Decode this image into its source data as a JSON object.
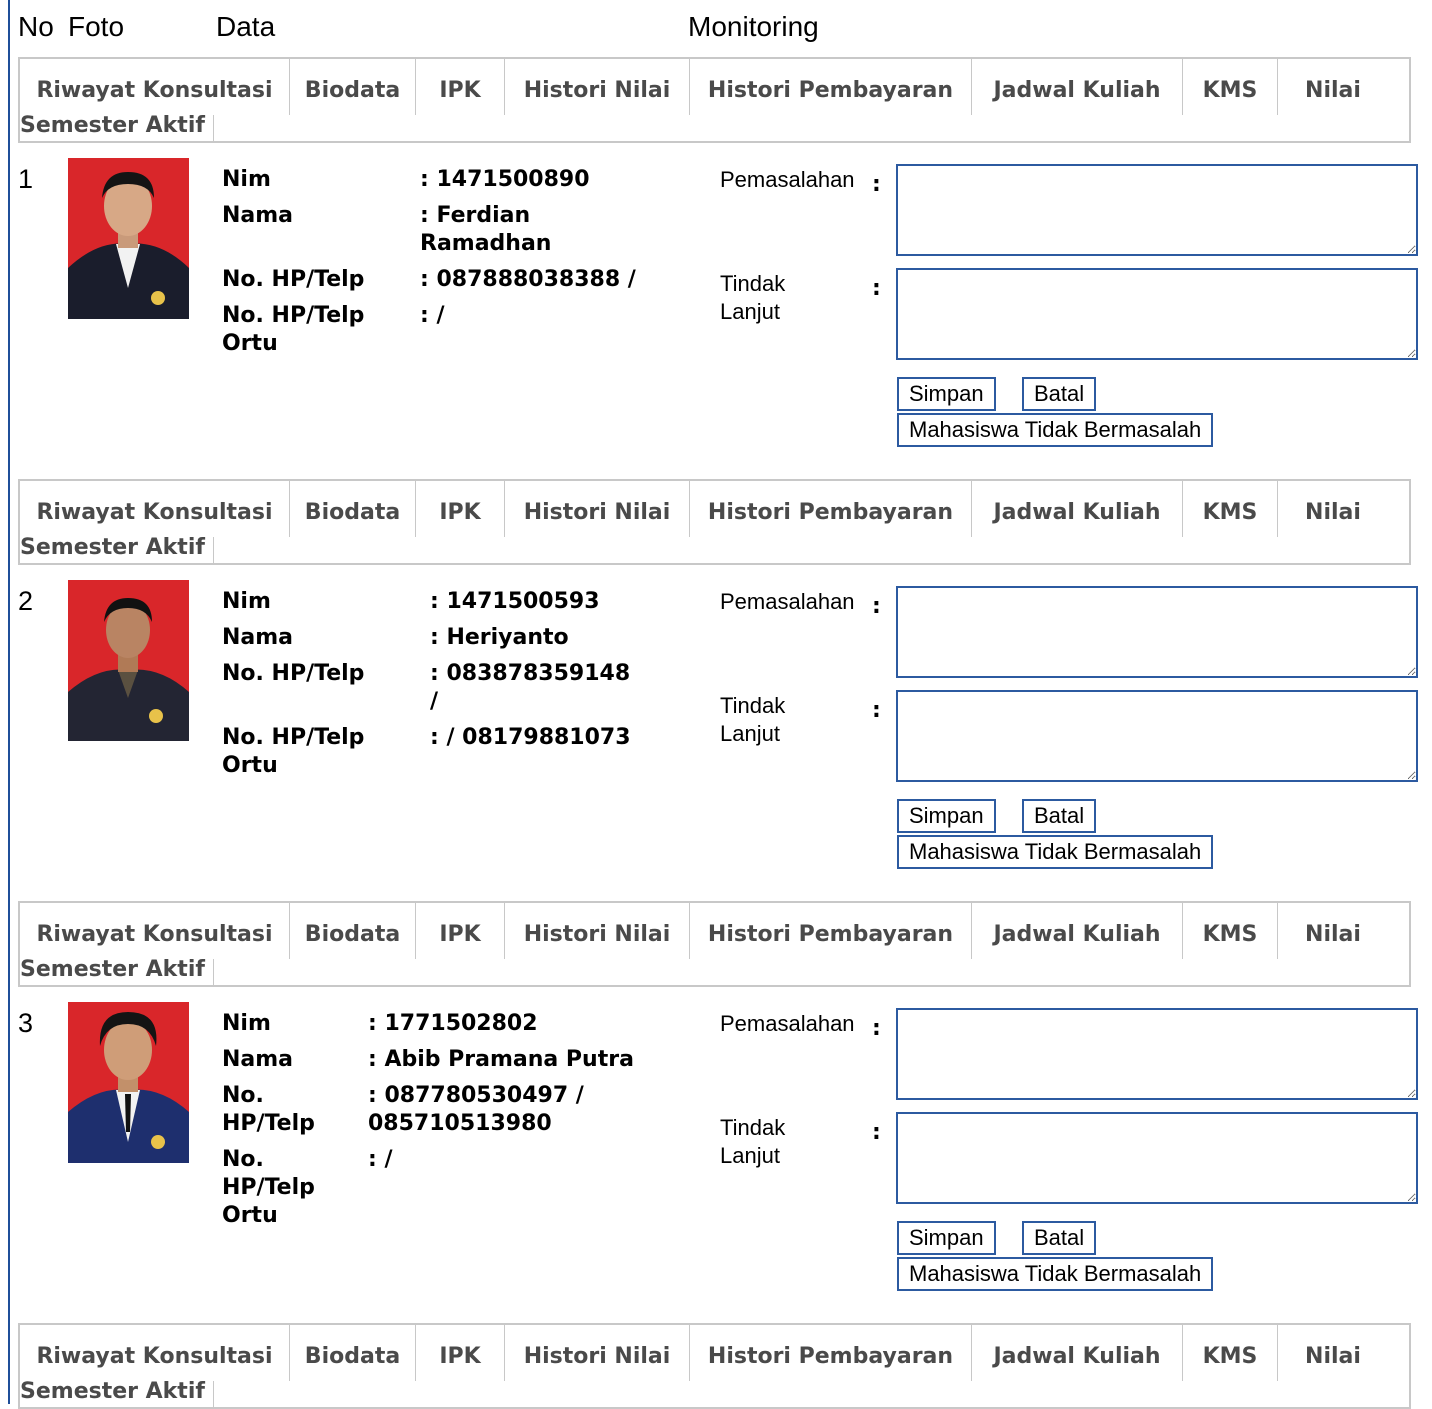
{
  "header": {
    "no": "No",
    "foto": "Foto",
    "data": "Data",
    "monitoring": "Monitoring"
  },
  "tabs": [
    "Riwayat Konsultasi",
    "Biodata",
    "IPK",
    "Histori Nilai",
    "Histori Pembayaran",
    "Jadwal Kuliah",
    "KMS",
    "Nilai"
  ],
  "tab_last": "Semester Aktif",
  "labels": {
    "nim": "Nim",
    "nama": "Nama",
    "hp": "No. HP/Telp",
    "hp_ortu": "No. HP/Telp Ortu",
    "pemasalahan": "Pemasalahan",
    "tindak_lanjut": "Tindak Lanjut",
    "colon": ":"
  },
  "buttons": {
    "simpan": "Simpan",
    "batal": "Batal",
    "tidak_bermasalah": "Mahasiswa Tidak Bermasalah"
  },
  "students": [
    {
      "no": "1",
      "nim": ": 1471500890",
      "nama": ": Ferdian Ramadhan",
      "hp": ": 087888038388 /",
      "hp_ortu": ": /"
    },
    {
      "no": "2",
      "nim": ": 1471500593",
      "nama": ": Heriyanto",
      "hp": ": 083878359148 /",
      "hp_ortu": ": / 08179881073"
    },
    {
      "no": "3",
      "nim": ": 1771502802",
      "nama": ": Abib Pramana Putra",
      "hp": ": 087780530497 / 085710513980",
      "hp_ortu": ": /"
    }
  ],
  "colors": {
    "frame": "#1f4f99",
    "input_border": "#2c5aa0",
    "photo_bg": "#d9262a",
    "tab_text": "#4a4a4a"
  }
}
